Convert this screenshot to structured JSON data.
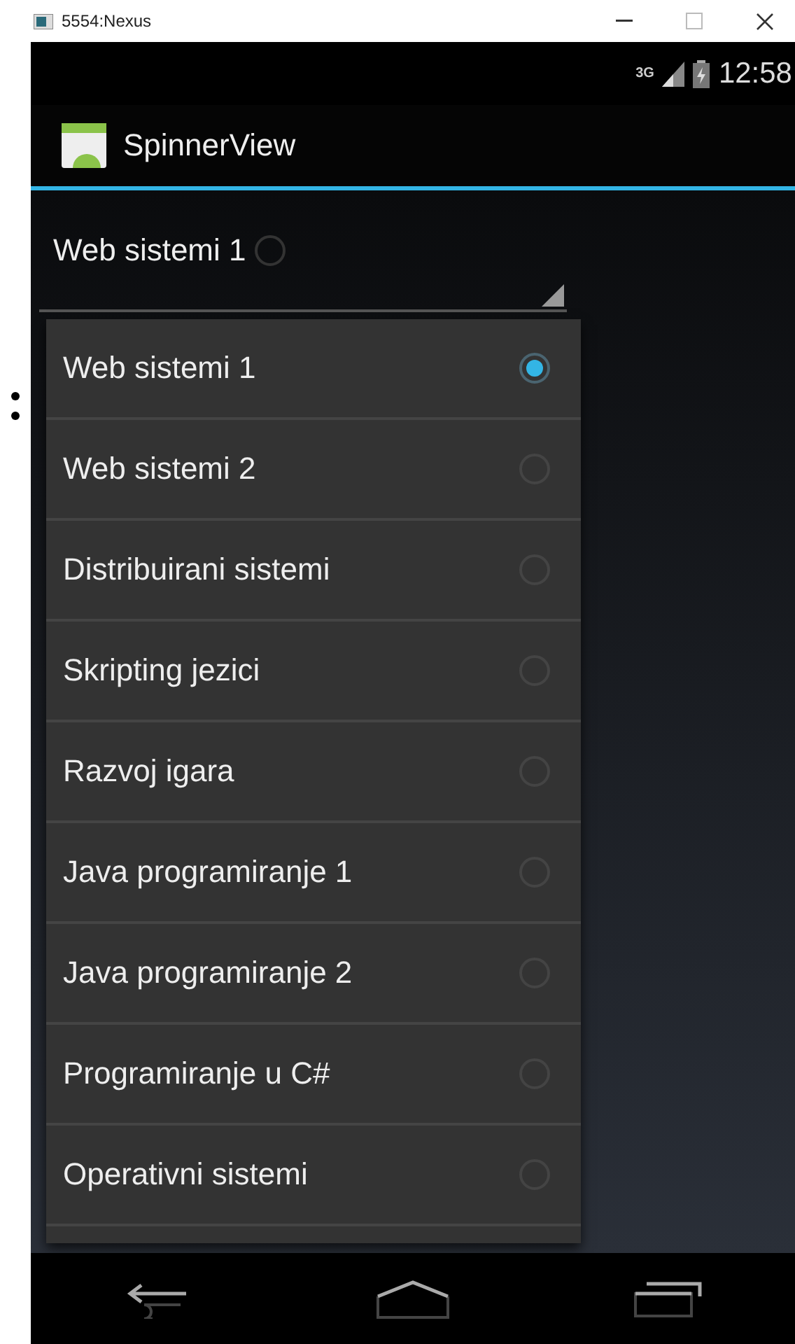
{
  "window": {
    "title": "5554:Nexus"
  },
  "status_bar": {
    "network": "3G",
    "time": "12:58"
  },
  "action_bar": {
    "title": "SpinnerView"
  },
  "spinner": {
    "value": "Web sistemi 1"
  },
  "dropdown": {
    "items": [
      {
        "label": "Web sistemi 1",
        "selected": true
      },
      {
        "label": "Web sistemi 2",
        "selected": false
      },
      {
        "label": "Distribuirani sistemi",
        "selected": false
      },
      {
        "label": "Skripting jezici",
        "selected": false
      },
      {
        "label": "Razvoj igara",
        "selected": false
      },
      {
        "label": "Java programiranje 1",
        "selected": false
      },
      {
        "label": "Java programiranje 2",
        "selected": false
      },
      {
        "label": "Programiranje u C#",
        "selected": false
      },
      {
        "label": "Operativni sistemi",
        "selected": false
      }
    ]
  }
}
